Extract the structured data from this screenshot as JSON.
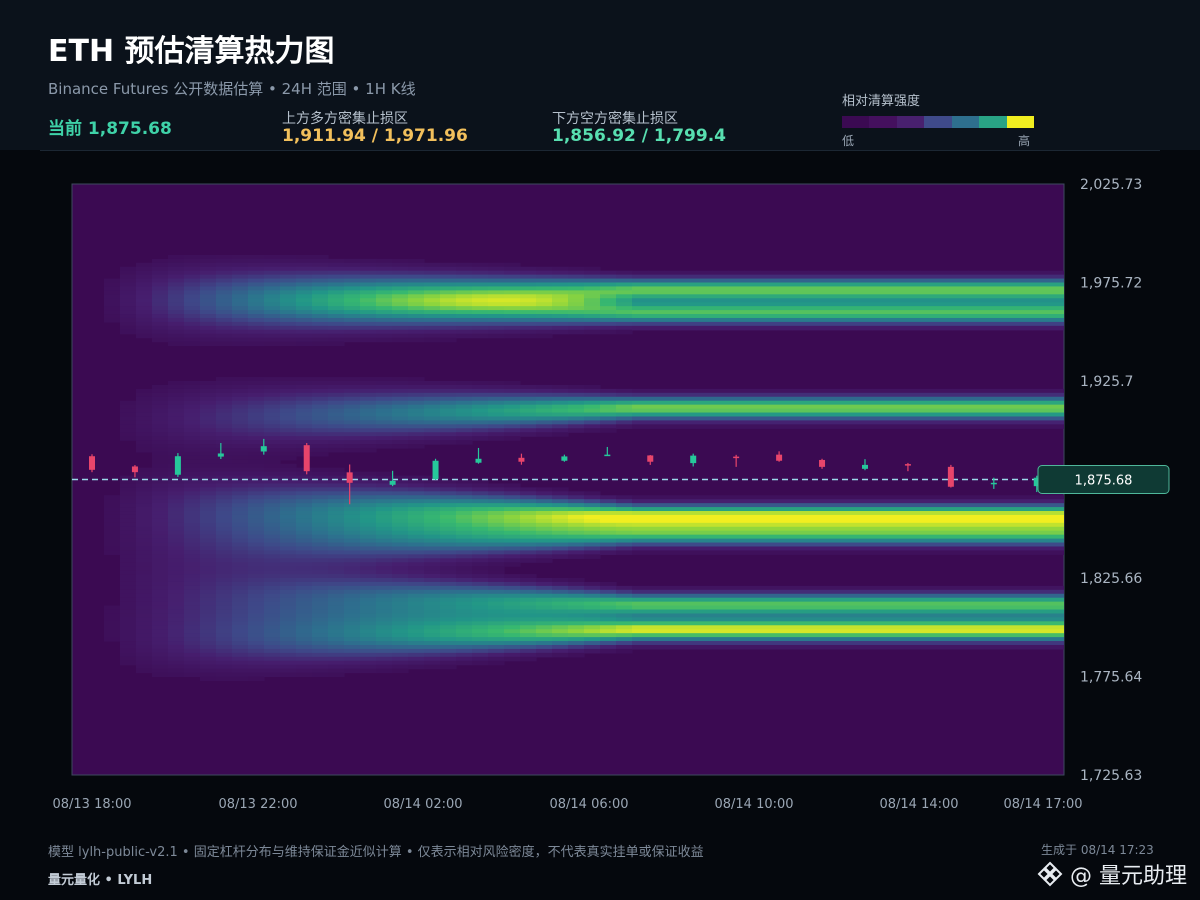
{
  "header": {
    "title": "ETH 预估清算热力图",
    "subtitle": "Binance Futures 公开数据估算 • 24H 范围 • 1H K线",
    "current": "当前 1,875.68",
    "upper_label": "上方多方密集止损区",
    "upper_value": "1,911.94 / 1,971.96",
    "lower_label": "下方空方密集止损区",
    "lower_value": "1,856.92 / 1,799.4"
  },
  "legend": {
    "title": "相对清算强度",
    "low": "低",
    "high": "高",
    "colors": [
      "#3b0a52",
      "#44105e",
      "#48206e",
      "#3f4a8a",
      "#2e6f8e",
      "#29a385",
      "#f1ee20"
    ]
  },
  "footer": {
    "note": "模型 lylh-public-v2.1 • 固定杠杆分布与维持保证金近似计算 • 仅表示相对风险密度，不代表真实挂单或保证收益",
    "brand": "量元量化 • LYLH",
    "generated": "生成于 08/14 17:23",
    "watermark": "@ 量元助理"
  },
  "chart_data": {
    "type": "heatmap",
    "x_ticks": [
      "08/13 18:00",
      "08/13 22:00",
      "08/14 02:00",
      "08/14 06:00",
      "08/14 10:00",
      "08/14 14:00",
      "08/14 17:00"
    ],
    "y_ticks": [
      "2,025.73",
      "1,975.72",
      "1,925.7",
      "1,875.68",
      "1,825.66",
      "1,775.64",
      "1,725.63"
    ],
    "ylim": [
      1725.63,
      2025.73
    ],
    "current_price": 1875.68,
    "current_price_label": "1,875.68",
    "grid": false,
    "colors": {
      "up": "#26c89b",
      "down": "#e8456b",
      "current_line": "#9ad8e8"
    },
    "bands": [
      {
        "price": 1971.96,
        "max_intensity": 0.82
      },
      {
        "price": 1960.5,
        "max_intensity": 0.78
      },
      {
        "price": 1911.94,
        "max_intensity": 0.85
      },
      {
        "price": 1856.92,
        "max_intensity": 1.0
      },
      {
        "price": 1848.0,
        "max_intensity": 0.74
      },
      {
        "price": 1812.0,
        "max_intensity": 0.8
      },
      {
        "price": 1799.4,
        "max_intensity": 0.98
      }
    ],
    "candles": [
      {
        "open": 1887.5,
        "close": 1880.6,
        "high": 1888.5,
        "low": 1879.4
      },
      {
        "open": 1882.3,
        "close": 1879.4,
        "high": 1883.0,
        "low": 1876.8
      },
      {
        "open": 1878.1,
        "close": 1887.5,
        "high": 1889.1,
        "low": 1877.0
      },
      {
        "open": 1887.3,
        "close": 1888.9,
        "high": 1894.2,
        "low": 1886.1
      },
      {
        "open": 1889.9,
        "close": 1892.6,
        "high": 1896.3,
        "low": 1888.3
      },
      {
        "open": 1893.1,
        "close": 1879.9,
        "high": 1894.2,
        "low": 1878.3
      },
      {
        "open": 1879.3,
        "close": 1874.0,
        "high": 1883.3,
        "low": 1863.1
      },
      {
        "open": 1873.0,
        "close": 1875.0,
        "high": 1880.1,
        "low": 1872.3
      },
      {
        "open": 1876.0,
        "close": 1885.2,
        "high": 1886.2,
        "low": 1875.4
      },
      {
        "open": 1884.2,
        "close": 1886.2,
        "high": 1891.7,
        "low": 1883.7
      },
      {
        "open": 1886.7,
        "close": 1884.7,
        "high": 1888.8,
        "low": 1883.2
      },
      {
        "open": 1885.2,
        "close": 1887.4,
        "high": 1888.3,
        "low": 1884.7
      },
      {
        "open": 1887.9,
        "close": 1888.3,
        "high": 1892.2,
        "low": 1887.9
      },
      {
        "open": 1887.9,
        "close": 1884.7,
        "high": 1888.1,
        "low": 1883.1
      },
      {
        "open": 1884.0,
        "close": 1887.8,
        "high": 1888.8,
        "low": 1882.3
      },
      {
        "open": 1887.3,
        "close": 1886.8,
        "high": 1888.2,
        "low": 1882.1
      },
      {
        "open": 1888.3,
        "close": 1885.2,
        "high": 1890.0,
        "low": 1884.7
      },
      {
        "open": 1885.6,
        "close": 1882.1,
        "high": 1886.2,
        "low": 1881.1
      },
      {
        "open": 1881.1,
        "close": 1883.1,
        "high": 1886.0,
        "low": 1880.4
      },
      {
        "open": 1883.5,
        "close": 1882.8,
        "high": 1884.1,
        "low": 1879.9
      },
      {
        "open": 1882.1,
        "close": 1872.0,
        "high": 1883.1,
        "low": 1871.6
      },
      {
        "open": 1873.5,
        "close": 1874.0,
        "high": 1876.6,
        "low": 1870.9
      },
      {
        "open": 1872.3,
        "close": 1876.6,
        "high": 1877.6,
        "low": 1869.3
      }
    ]
  }
}
